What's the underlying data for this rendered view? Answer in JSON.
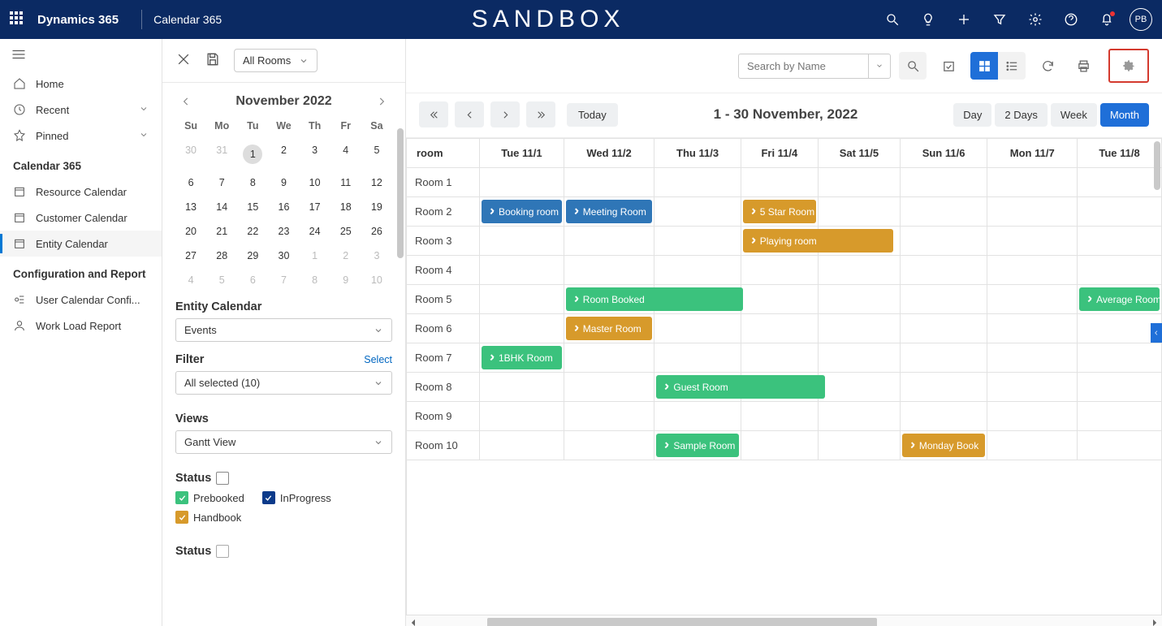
{
  "topbar": {
    "app": "Dynamics 365",
    "subapp": "Calendar 365",
    "sandbox": "SANDBOX",
    "avatar": "PB"
  },
  "leftnav": {
    "items1": [
      {
        "label": "Home"
      },
      {
        "label": "Recent"
      },
      {
        "label": "Pinned"
      }
    ],
    "section1": "Calendar 365",
    "calItems": [
      {
        "label": "Resource Calendar"
      },
      {
        "label": "Customer Calendar"
      },
      {
        "label": "Entity Calendar"
      }
    ],
    "section2": "Configuration and Report",
    "cfgItems": [
      {
        "label": "User Calendar Confi..."
      },
      {
        "label": "Work Load Report"
      }
    ]
  },
  "mid": {
    "roomSelect": "All Rooms",
    "monthTitle": "November 2022",
    "dow": [
      "Su",
      "Mo",
      "Tu",
      "We",
      "Th",
      "Fr",
      "Sa"
    ],
    "weeks": [
      [
        {
          "d": "30",
          "m": true
        },
        {
          "d": "31",
          "m": true
        },
        {
          "d": "1",
          "t": true
        },
        {
          "d": "2"
        },
        {
          "d": "3"
        },
        {
          "d": "4"
        },
        {
          "d": "5"
        }
      ],
      [
        {
          "d": "6"
        },
        {
          "d": "7"
        },
        {
          "d": "8"
        },
        {
          "d": "9"
        },
        {
          "d": "10"
        },
        {
          "d": "11"
        },
        {
          "d": "12"
        }
      ],
      [
        {
          "d": "13"
        },
        {
          "d": "14"
        },
        {
          "d": "15"
        },
        {
          "d": "16"
        },
        {
          "d": "17"
        },
        {
          "d": "18"
        },
        {
          "d": "19"
        }
      ],
      [
        {
          "d": "20"
        },
        {
          "d": "21"
        },
        {
          "d": "22"
        },
        {
          "d": "23"
        },
        {
          "d": "24"
        },
        {
          "d": "25"
        },
        {
          "d": "26"
        }
      ],
      [
        {
          "d": "27"
        },
        {
          "d": "28"
        },
        {
          "d": "29"
        },
        {
          "d": "30"
        },
        {
          "d": "1",
          "m": true
        },
        {
          "d": "2",
          "m": true
        },
        {
          "d": "3",
          "m": true
        }
      ],
      [
        {
          "d": "4",
          "m": true
        },
        {
          "d": "5",
          "m": true
        },
        {
          "d": "6",
          "m": true
        },
        {
          "d": "7",
          "m": true
        },
        {
          "d": "8",
          "m": true
        },
        {
          "d": "9",
          "m": true
        },
        {
          "d": "10",
          "m": true
        }
      ]
    ],
    "entityTitle": "Entity Calendar",
    "entitySelect": "Events",
    "filterTitle": "Filter",
    "selectLink": "Select",
    "filterSelect": "All selected (10)",
    "viewsTitle": "Views",
    "viewsSelect": "Gantt View",
    "statusTitle": "Status",
    "status1": "Prebooked",
    "status2": "InProgress",
    "status3": "Handbook",
    "status2Title": "Status"
  },
  "toolbar": {
    "searchPlaceholder": "Search by Name"
  },
  "daterow": {
    "today": "Today",
    "title": "1 - 30 November, 2022",
    "ranges": [
      "Day",
      "2 Days",
      "Week",
      "Month"
    ],
    "activeRange": 3
  },
  "gantt": {
    "roomHeader": "room",
    "cols": [
      "Tue 11/1",
      "Wed 11/2",
      "Thu 11/3",
      "Fri 11/4",
      "Sat 11/5",
      "Sun 11/6",
      "Mon 11/7",
      "Tue 11/8"
    ],
    "rooms": [
      "Room 1",
      "Room 2",
      "Room 3",
      "Room 4",
      "Room 5",
      "Room 6",
      "Room 7",
      "Room 8",
      "Room 9",
      "Room 10"
    ],
    "events": [
      {
        "room": 1,
        "start": 0,
        "span": 1,
        "label": "Booking room",
        "cls": "ev-blue"
      },
      {
        "room": 1,
        "start": 1,
        "span": 1,
        "label": "Meeting Room",
        "cls": "ev-blue"
      },
      {
        "room": 1,
        "start": 3,
        "span": 1,
        "label": "5 Star Room",
        "cls": "ev-orange"
      },
      {
        "room": 2,
        "start": 3,
        "span": 2,
        "label": "Playing room",
        "cls": "ev-orange"
      },
      {
        "room": 4,
        "start": 1,
        "span": 2,
        "label": "Room Booked",
        "cls": "ev-green"
      },
      {
        "room": 4,
        "start": 7,
        "span": 1,
        "label": "Average Room",
        "cls": "ev-green"
      },
      {
        "room": 5,
        "start": 1,
        "span": 1,
        "label": "Master Room",
        "cls": "ev-orange"
      },
      {
        "room": 6,
        "start": 0,
        "span": 1,
        "label": "1BHK Room",
        "cls": "ev-green"
      },
      {
        "room": 7,
        "start": 2,
        "span": 2,
        "label": "Guest Room",
        "cls": "ev-green"
      },
      {
        "room": 9,
        "start": 2,
        "span": 1,
        "label": "Sample Room",
        "cls": "ev-green"
      },
      {
        "room": 9,
        "start": 5,
        "span": 1,
        "label": "Monday Book",
        "cls": "ev-orange"
      }
    ]
  }
}
